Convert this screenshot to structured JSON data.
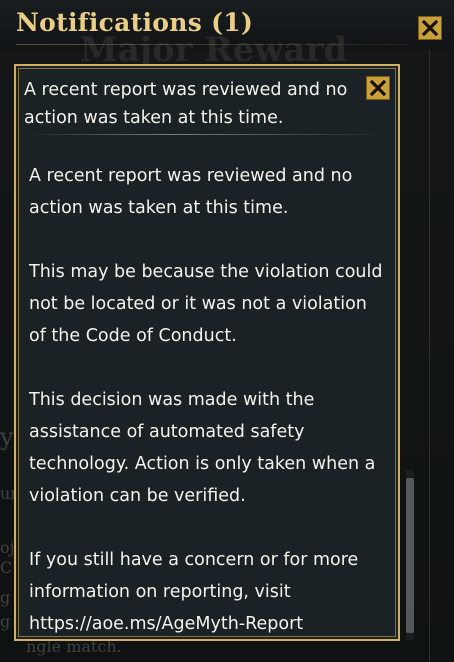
{
  "header": {
    "title": "Notifications (1)",
    "background_fragment": "Major Reward",
    "close_icon": "close-icon"
  },
  "background_fragments": [
    "y",
    "ur",
    "oj",
    "C",
    "g",
    "g",
    "ngle match."
  ],
  "tooltip": {
    "title": "A recent report was reviewed and no action was taken at this time.",
    "close_icon": "close-icon",
    "paragraphs": [
      "A recent report was reviewed and no action was taken at this time.",
      "This may be because the violation could not be located or it was not a violation of the Code of Conduct.",
      "This decision was made with the assistance of automated safety technology. Action is only taken when a violation can be verified.",
      "If you still have a concern or for more information on reporting, visit https://aoe.ms/AgeMyth-Report"
    ]
  },
  "colors": {
    "title_gold": "#e9cf86",
    "border_gold": "#d2b062",
    "button_gold": "#c9a13c",
    "panel_bg": "#1b2226",
    "text": "#f4f2ec"
  }
}
